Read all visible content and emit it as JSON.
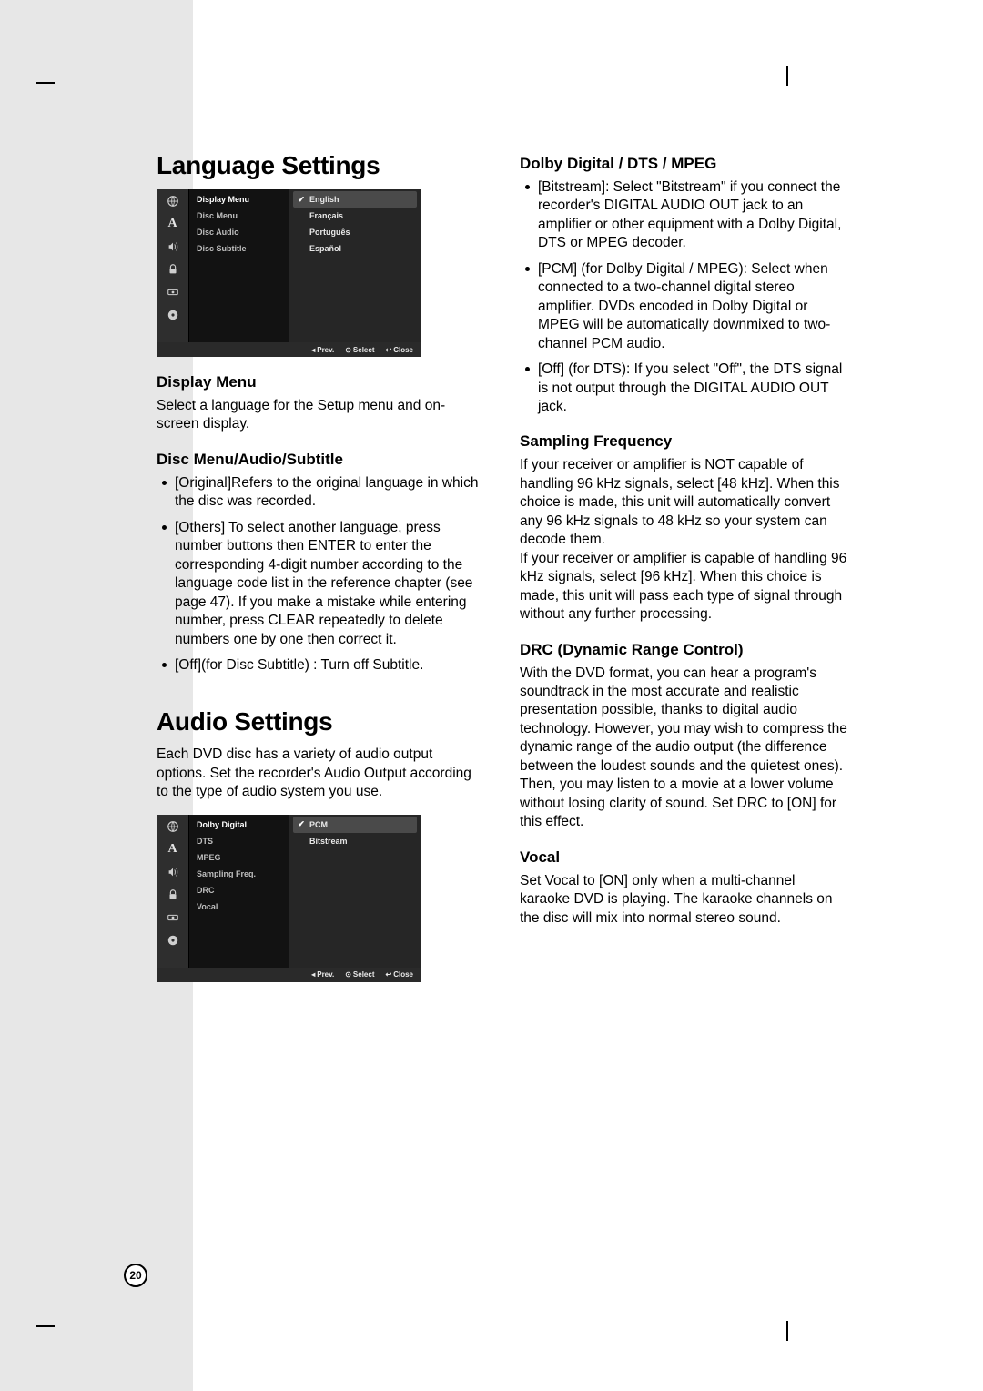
{
  "page_number": "20",
  "left": {
    "heading_language": "Language Settings",
    "osd1": {
      "menu_items": [
        "Display Menu",
        "Disc Menu",
        "Disc Audio",
        "Disc Subtitle"
      ],
      "options": [
        {
          "label": "English",
          "selected": true
        },
        {
          "label": "Français",
          "selected": false
        },
        {
          "label": "Português",
          "selected": false
        },
        {
          "label": "Español",
          "selected": false
        }
      ],
      "footer": {
        "prev": "Prev.",
        "select": "Select",
        "close": "Close"
      }
    },
    "sub_display_menu": "Display Menu",
    "display_menu_text": "Select a language for the Setup menu and on-screen display.",
    "sub_disc": "Disc Menu/Audio/Subtitle",
    "disc_bullets": [
      "[Original]Refers to the original language in which the disc was recorded.",
      "[Others] To select another language, press number buttons then ENTER to enter the corresponding 4-digit number according to the language code list in the reference chapter (see page 47). If you make a mistake while entering number, press CLEAR repeatedly to delete numbers one by one then correct it.",
      "[Off](for Disc Subtitle) : Turn off Subtitle."
    ],
    "heading_audio": "Audio Settings",
    "audio_intro": "Each DVD disc has a variety of audio output options. Set the recorder's Audio Output according to the type of audio system you use.",
    "osd2": {
      "menu_items": [
        "Dolby Digital",
        "DTS",
        "MPEG",
        "Sampling Freq.",
        "DRC",
        "Vocal"
      ],
      "options": [
        {
          "label": "PCM",
          "selected": true
        },
        {
          "label": "Bitstream",
          "selected": false
        }
      ],
      "footer": {
        "prev": "Prev.",
        "select": "Select",
        "close": "Close"
      }
    }
  },
  "right": {
    "sub_dolby": "Dolby Digital / DTS / MPEG",
    "dolby_bullets": [
      "[Bitstream]: Select \"Bitstream\" if you connect the recorder's DIGITAL AUDIO OUT jack to an amplifier or other equipment with a Dolby Digital, DTS or MPEG decoder.",
      "[PCM] (for Dolby Digital / MPEG): Select when connected to a two-channel digital stereo amplifier. DVDs encoded in Dolby Digital or MPEG will be automatically downmixed to two-channel PCM audio.",
      "[Off] (for DTS): If you select \"Off\", the DTS signal is not output through the DIGITAL AUDIO OUT jack."
    ],
    "sub_sampling": "Sampling Frequency",
    "sampling_p1": "If your receiver or amplifier is NOT capable of handling 96 kHz signals, select [48 kHz]. When this choice is made, this unit will automatically convert any 96 kHz signals to 48 kHz so your system can decode them.",
    "sampling_p2": "If your receiver or amplifier is capable of handling 96 kHz signals, select [96 kHz]. When this choice is made, this unit will pass each type of signal through without any further processing.",
    "sub_drc": "DRC (Dynamic Range Control)",
    "drc_text": "With the DVD format, you can hear a program's soundtrack in the most accurate and realistic presentation possible, thanks to digital audio technology. However, you may wish to compress the dynamic range of the audio output (the difference between the loudest sounds and the quietest ones). Then, you may listen to a movie at a lower volume without losing clarity of sound. Set DRC to [ON] for this effect.",
    "sub_vocal": "Vocal",
    "vocal_text": "Set Vocal to [ON] only when a multi-channel karaoke DVD is playing. The karaoke channels on the disc will mix into normal stereo sound."
  },
  "icons": {
    "names": [
      "globe-icon",
      "letter-a-icon",
      "speaker-icon",
      "lock-icon",
      "rec-icon",
      "disc-icon"
    ]
  }
}
